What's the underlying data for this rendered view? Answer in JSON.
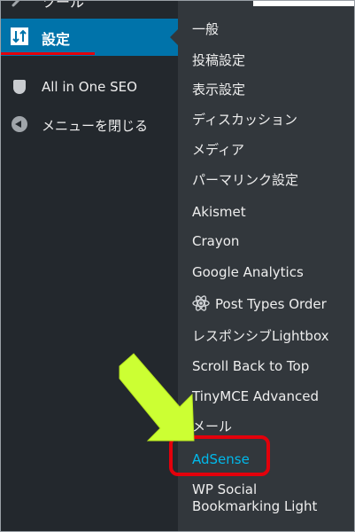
{
  "sidebar": {
    "top_item": {
      "label": "ツール",
      "icon": "wrench-icon"
    },
    "current_item": {
      "label": "設定",
      "icon": "settings-icon",
      "accent": "#0073aa"
    },
    "items": [
      {
        "label": "All in One SEO",
        "icon": "shield-icon"
      },
      {
        "label": "メニューを閉じる",
        "icon": "collapse-icon"
      }
    ],
    "background": "#23282d"
  },
  "submenu": {
    "background": "#32373c",
    "items": [
      {
        "label": "一般"
      },
      {
        "label": "投稿設定"
      },
      {
        "label": "表示設定"
      },
      {
        "label": "ディスカッション"
      },
      {
        "label": "メディア"
      },
      {
        "label": "パーマリンク設定"
      },
      {
        "label": "Akismet"
      },
      {
        "label": "Crayon"
      },
      {
        "label": "Google Analytics"
      },
      {
        "label": "Post Types Order",
        "icon": "atom-icon"
      },
      {
        "label": "レスポンシブLightbox"
      },
      {
        "label": "Scroll Back to Top"
      },
      {
        "label": "TinyMCE Advanced"
      },
      {
        "label": "メール"
      },
      {
        "label": "AdSense",
        "current": true,
        "color": "#00b9eb"
      },
      {
        "label_line1": "WP Social",
        "label_line2": "Bookmarking Light"
      }
    ]
  },
  "annotations": {
    "highlight_color": "#e3000b",
    "arrow_color": "#ccff33"
  }
}
